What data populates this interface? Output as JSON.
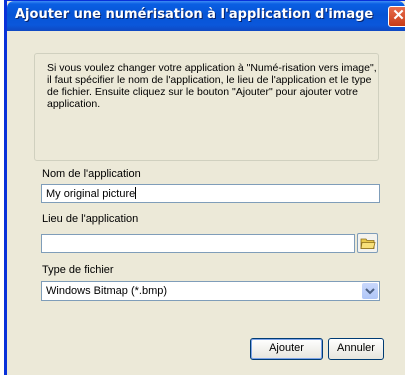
{
  "window": {
    "title": "Ajouter une numérisation à l'application d'image",
    "close_glyph": "✕"
  },
  "instructions": "Si vous voulez changer votre application à \"Numé-risation vers image\", il faut spécifier le nom de l'application, le lieu de l'application et le type de fichier. Ensuite cliquez sur le bouton \"Ajouter\" pour ajouter votre application.",
  "form": {
    "name_label": "Nom de l'application",
    "name_value": "My original picture",
    "location_label": "Lieu de l'application",
    "location_value": "",
    "filetype_label": "Type de fichier",
    "filetype_value": "Windows Bitmap (*.bmp)"
  },
  "buttons": {
    "add": "Ajouter",
    "cancel": "Annuler"
  },
  "icons": {
    "close": "close-icon",
    "browse": "folder-icon",
    "dropdown": "chevron-down-icon"
  }
}
